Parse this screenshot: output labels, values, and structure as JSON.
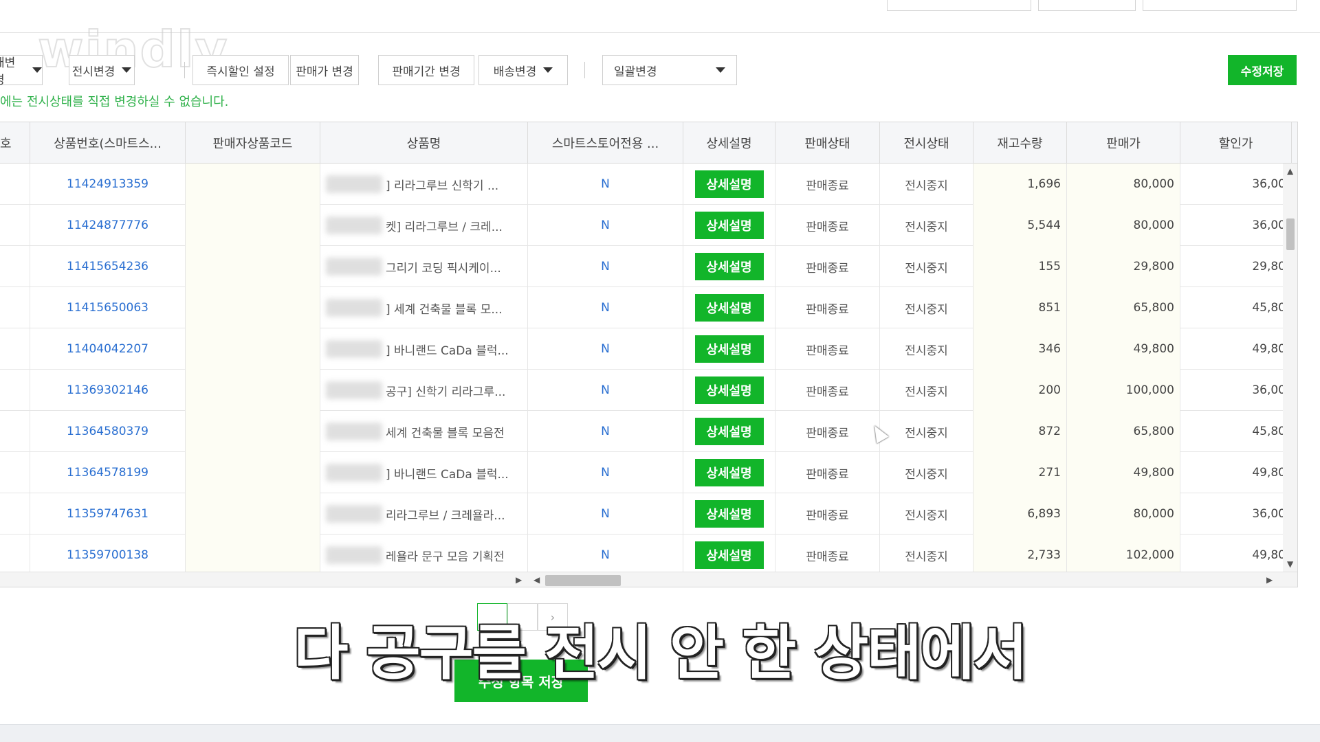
{
  "watermark": "windly",
  "toolbar": {
    "buttons": [
      {
        "label": "매변경",
        "dropdown": true
      },
      {
        "label": "전시변경",
        "dropdown": true
      },
      {
        "label": "즉시할인 설정",
        "dropdown": false
      },
      {
        "label": "판매가 변경",
        "dropdown": false
      },
      {
        "label": "판매기간 변경",
        "dropdown": false
      },
      {
        "label": "배송변경",
        "dropdown": true
      }
    ],
    "bulk_select": "일괄변경",
    "save_label": "수정저장"
  },
  "notice": "에는 전시상태를 직접 변경하실 수 없습니다.",
  "table": {
    "columns": [
      "호",
      "상품번호(스마트스...",
      "판매자상품코드",
      "상품명",
      "스마트스토어전용 ...",
      "상세설명",
      "판매상태",
      "전시상태",
      "재고수량",
      "판매가",
      "할인가"
    ],
    "rows": [
      {
        "no": "11424913359",
        "code": "",
        "name": "] 리라그루브 신학기 ...",
        "exclusive": "N",
        "detail": "상세설명",
        "sale_status": "판매종료",
        "display_status": "전시중지",
        "stock": "1,696",
        "price": "80,000",
        "discount": "36,00"
      },
      {
        "no": "11424877776",
        "code": "",
        "name": "켓] 리라그루브 / 크레...",
        "exclusive": "N",
        "detail": "상세설명",
        "sale_status": "판매종료",
        "display_status": "전시중지",
        "stock": "5,544",
        "price": "80,000",
        "discount": "36,00"
      },
      {
        "no": "11415654236",
        "code": "",
        "name": "그리기 코딩 픽시케이...",
        "exclusive": "N",
        "detail": "상세설명",
        "sale_status": "판매종료",
        "display_status": "전시중지",
        "stock": "155",
        "price": "29,800",
        "discount": "29,80"
      },
      {
        "no": "11415650063",
        "code": "",
        "name": "] 세계 건축물 블록 모...",
        "exclusive": "N",
        "detail": "상세설명",
        "sale_status": "판매종료",
        "display_status": "전시중지",
        "stock": "851",
        "price": "65,800",
        "discount": "45,80"
      },
      {
        "no": "11404042207",
        "code": "",
        "name": "] 바니랜드 CaDa 블럭...",
        "exclusive": "N",
        "detail": "상세설명",
        "sale_status": "판매종료",
        "display_status": "전시중지",
        "stock": "346",
        "price": "49,800",
        "discount": "49,80"
      },
      {
        "no": "11369302146",
        "code": "",
        "name": "공구] 신학기 리라그루...",
        "exclusive": "N",
        "detail": "상세설명",
        "sale_status": "판매종료",
        "display_status": "전시중지",
        "stock": "200",
        "price": "100,000",
        "discount": "36,00"
      },
      {
        "no": "11364580379",
        "code": "",
        "name": "세계 건축물 블록 모음전",
        "exclusive": "N",
        "detail": "상세설명",
        "sale_status": "판매종료",
        "display_status": "전시중지",
        "stock": "872",
        "price": "65,800",
        "discount": "45,80"
      },
      {
        "no": "11364578199",
        "code": "",
        "name": "] 바니랜드 CaDa 블럭...",
        "exclusive": "N",
        "detail": "상세설명",
        "sale_status": "판매종료",
        "display_status": "전시중지",
        "stock": "271",
        "price": "49,800",
        "discount": "49,80"
      },
      {
        "no": "11359747631",
        "code": "",
        "name": "리라그루브 / 크레욜라...",
        "exclusive": "N",
        "detail": "상세설명",
        "sale_status": "판매종료",
        "display_status": "전시중지",
        "stock": "6,893",
        "price": "80,000",
        "discount": "36,00"
      },
      {
        "no": "11359700138",
        "code": "",
        "name": "레욜라 문구 모음 기획전",
        "exclusive": "N",
        "detail": "상세설명",
        "sale_status": "판매종료",
        "display_status": "전시중지",
        "stock": "2,733",
        "price": "102,000",
        "discount": "49,80"
      }
    ]
  },
  "bottom_save_label": "수정 항목 저장",
  "subtitle": "다 공구를 전시 안 한 상태에서",
  "colors": {
    "accent_green": "#12b52a",
    "link_blue": "#2a6fd1",
    "notice_green": "#2fb14a"
  }
}
